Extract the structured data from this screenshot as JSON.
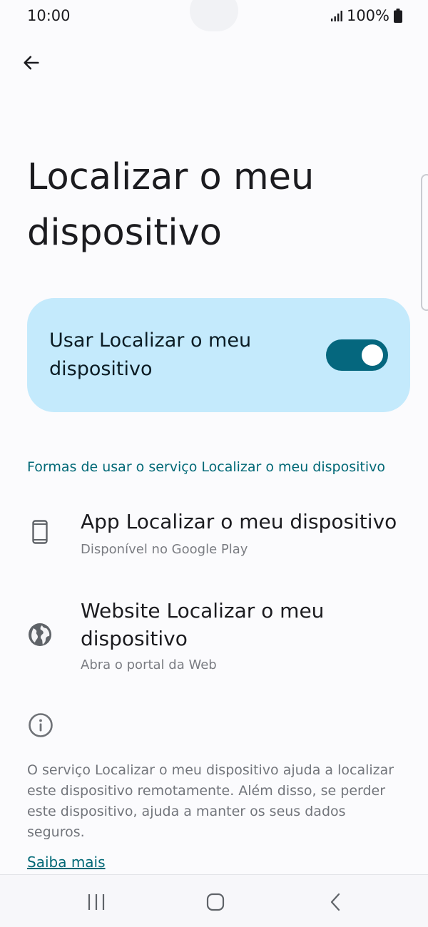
{
  "status_bar": {
    "time": "10:00",
    "battery": "100%"
  },
  "header": {
    "title": "Localizar o meu dispositivo"
  },
  "main_toggle": {
    "label": "Usar Localizar o meu dispositivo",
    "enabled": true
  },
  "section": {
    "header": "Formas de usar o serviço Localizar o meu dispositivo"
  },
  "items": [
    {
      "icon": "phone-icon",
      "title": "App Localizar o meu dispositivo",
      "subtitle": "Disponível no Google Play"
    },
    {
      "icon": "globe-icon",
      "title": "Website Localizar o meu dispositivo",
      "subtitle": "Abra o portal da Web"
    }
  ],
  "info": {
    "icon": "info-icon",
    "text": "O serviço Localizar o meu dispositivo ajuda a localizar este dispositivo remotamente. Além disso, se perder este dispositivo, ajuda a manter os seus dados seguros.",
    "link": "Saiba mais"
  },
  "colors": {
    "accent": "#006876",
    "card_background": "#c4eafc",
    "switch_track": "#05677e"
  },
  "nav_bar": {
    "buttons": [
      "recents-icon",
      "home-icon",
      "back-icon"
    ]
  }
}
